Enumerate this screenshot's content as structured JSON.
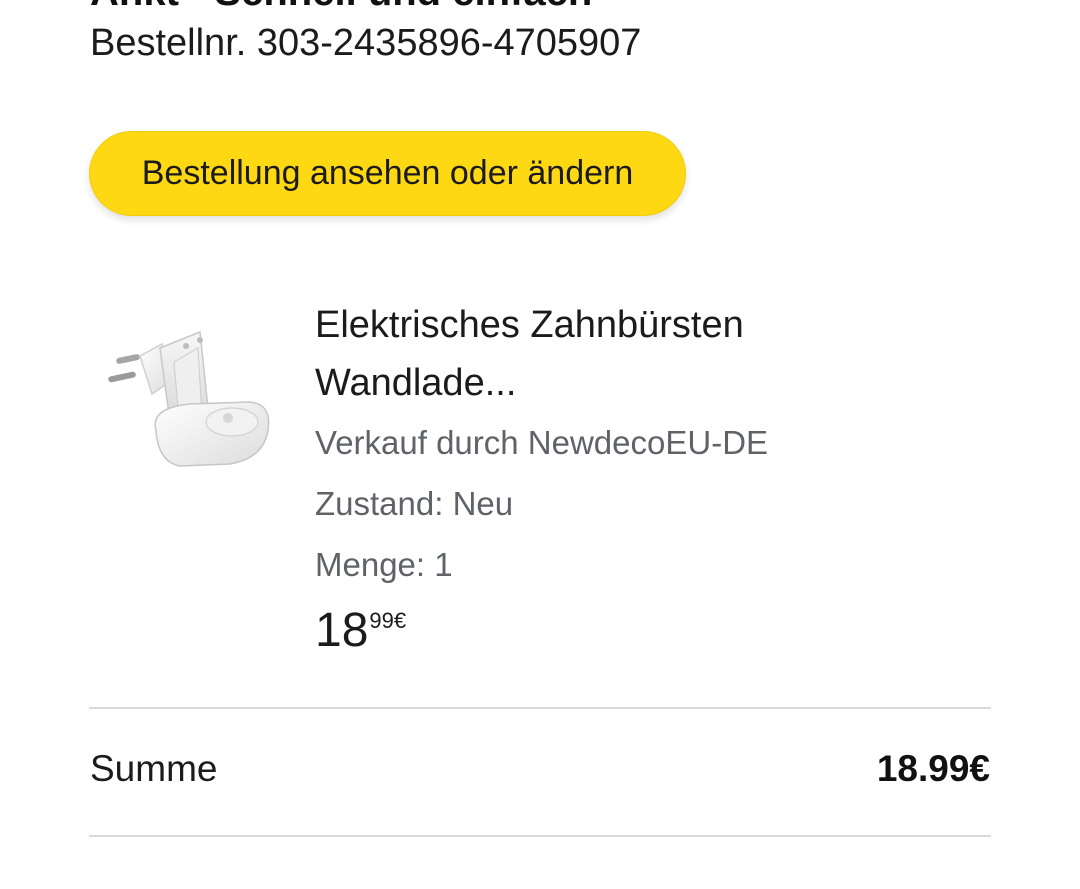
{
  "order": {
    "heading_partial": "Ankt - Schnell und einfach",
    "number_line": "Bestellnr. 303-2435896-4705907"
  },
  "actions": {
    "view_or_change_label": "Bestellung ansehen oder ändern"
  },
  "item": {
    "image_icon": "toothbrush-wall-charger-product-image",
    "title_line1": "Elektrisches Zahnbürsten",
    "title_line2": "Wandlade...",
    "seller": "Verkauf durch NewdecoEU-DE",
    "condition": "Zustand: Neu",
    "quantity": "Menge: 1",
    "price_whole": "18",
    "price_fraction": "99€"
  },
  "summary": {
    "label": "Summe",
    "value": "18.99€"
  },
  "colors": {
    "button_yellow": "#ffd814",
    "meta_gray": "#5f6368",
    "divider": "#d5d9d9"
  }
}
